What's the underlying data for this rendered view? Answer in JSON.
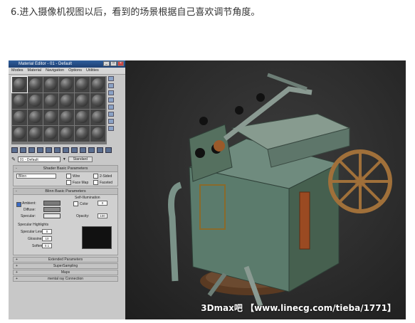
{
  "caption": "6.进入摄像机视图以后，看到的场景根据自己喜欢调节角度。",
  "watermark": "3Dmax吧 【www.linecg.com/tieba/1771】",
  "material_editor": {
    "title": "Material Editor - 01 - Default",
    "menu": [
      "Modes",
      "Material",
      "Navigation",
      "Options",
      "Utilities"
    ],
    "material_name": "01 - Default",
    "material_type": "Standard",
    "shader_rollout": {
      "title": "Shader Basic Parameters",
      "shader": "Blinn",
      "options": [
        "Wire",
        "2-Sided",
        "Face Map",
        "Faceted"
      ]
    },
    "blinn_rollout": {
      "title": "Blinn Basic Parameters",
      "self_illum_label": "Self-Illumination",
      "color_label": "Color",
      "color_value": "0",
      "ambient_label": "Ambient:",
      "diffuse_label": "Diffuse:",
      "specular_label": "Specular:",
      "opacity_label": "Opacity:",
      "opacity_value": "100",
      "spec_highlights_label": "Specular Highlights",
      "specular_level_label": "Specular Level:",
      "specular_level_value": "0",
      "glossiness_label": "Glossiness:",
      "glossiness_value": "10",
      "soften_label": "Soften:",
      "soften_value": "0.1"
    },
    "collapsed_rollouts": [
      "Extended Parameters",
      "SuperSampling",
      "Maps",
      "mental ray Connection"
    ]
  },
  "colors": {
    "titlebar": "#2f5d9b",
    "panel": "#c8c8c8",
    "viewport_bg": "#2c2c2c",
    "machine_teal": "#5f7f70",
    "rust": "#8a4a22"
  }
}
